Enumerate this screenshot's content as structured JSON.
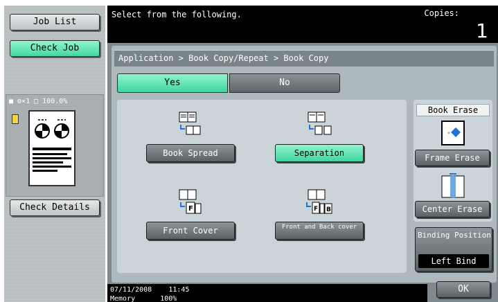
{
  "sidebar": {
    "job_list_label": "Job List",
    "check_job_label": "Check Job",
    "preview_info": "■ ⚙×1 □ 100.0%",
    "check_details_label": "Check Details"
  },
  "header": {
    "message": "Select from the following.",
    "copies_label": "Copies:",
    "copies_value": "1"
  },
  "main": {
    "breadcrumb": "Application > Book Copy/Repeat > Book Copy",
    "yes_label": "Yes",
    "no_label": "No",
    "selected_toggle": "Yes",
    "options": [
      {
        "label": "Book Spread",
        "selected": false
      },
      {
        "label": "Separation",
        "selected": true
      },
      {
        "label": "Front Cover",
        "selected": false
      },
      {
        "label": "Front and Back cover",
        "selected": false
      }
    ],
    "book_erase": {
      "title": "Book Erase",
      "frame_erase_label": "Frame Erase",
      "center_erase_label": "Center Erase"
    },
    "binding": {
      "label": "Binding Position",
      "value": "Left Bind"
    }
  },
  "status": {
    "date": "07/11/2008",
    "time": "11:45",
    "memory_label": "Memory",
    "memory_value": "100%"
  },
  "ok_label": "OK",
  "colors": {
    "accent_green": "#44d8a1",
    "panel_gray": "#aeb9be",
    "header_black": "#000000"
  }
}
